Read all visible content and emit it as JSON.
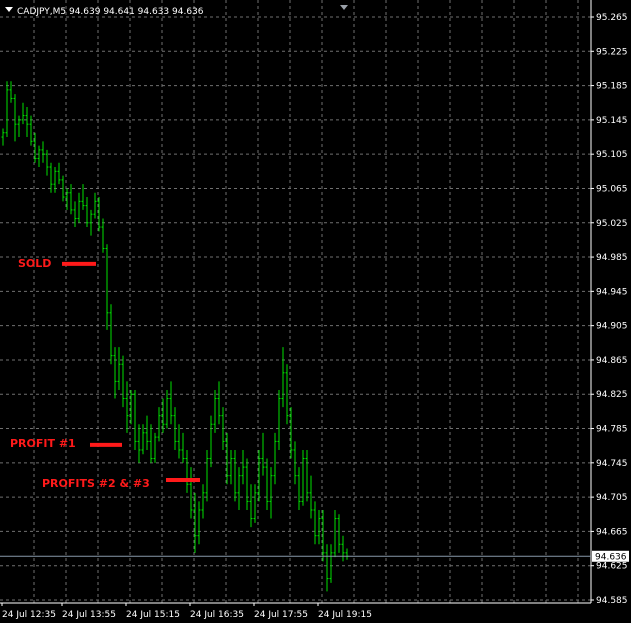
{
  "window": {
    "symbol_line": "CADJPY,M5  94.639 94.641 94.633 94.636",
    "current_price_label": "94.636"
  },
  "colors": {
    "background": "#000000",
    "grid": "#707070",
    "bars": "#00e000",
    "axis": "#ffffff",
    "annotation": "#ff1a1a",
    "current_line": "#8899aa"
  },
  "chart_data": {
    "type": "ohlc",
    "symbol": "CADJPY",
    "timeframe": "M5",
    "ylim": [
      94.575,
      95.275
    ],
    "y_ticks": [
      "95.265",
      "95.225",
      "95.185",
      "95.145",
      "95.105",
      "95.065",
      "95.025",
      "94.985",
      "94.945",
      "94.905",
      "94.865",
      "94.825",
      "94.785",
      "94.745",
      "94.705",
      "94.665",
      "94.625",
      "94.585"
    ],
    "x_ticks": [
      "24 Jul 12:35",
      "24 Jul 13:55",
      "24 Jul 15:15",
      "24 Jul 16:35",
      "24 Jul 17:55",
      "24 Jul 19:15"
    ],
    "current_price": 94.636,
    "grid": true,
    "annotations": [
      {
        "label": "SOLD",
        "price": 94.977
      },
      {
        "label": "PROFIT #1",
        "price": 94.766
      },
      {
        "label": "PROFITS #2 & #3",
        "price": 94.725
      }
    ],
    "bars": [
      [
        95.125,
        95.135,
        95.115,
        95.13
      ],
      [
        95.13,
        95.19,
        95.125,
        95.18
      ],
      [
        95.18,
        95.19,
        95.165,
        95.17
      ],
      [
        95.17,
        95.175,
        95.12,
        95.14
      ],
      [
        95.14,
        95.15,
        95.125,
        95.145
      ],
      [
        95.145,
        95.165,
        95.14,
        95.15
      ],
      [
        95.15,
        95.16,
        95.125,
        95.14
      ],
      [
        95.14,
        95.15,
        95.115,
        95.12
      ],
      [
        95.12,
        95.13,
        95.095,
        95.1
      ],
      [
        95.1,
        95.115,
        95.09,
        95.11
      ],
      [
        95.11,
        95.12,
        95.095,
        95.105
      ],
      [
        95.105,
        95.11,
        95.08,
        95.09
      ],
      [
        95.09,
        95.095,
        95.06,
        95.07
      ],
      [
        95.07,
        95.09,
        95.06,
        95.085
      ],
      [
        95.085,
        95.095,
        95.07,
        95.075
      ],
      [
        95.075,
        95.08,
        95.05,
        95.055
      ],
      [
        95.055,
        95.065,
        95.04,
        95.06
      ],
      [
        95.06,
        95.07,
        95.035,
        95.04
      ],
      [
        95.04,
        95.05,
        95.02,
        95.03
      ],
      [
        95.03,
        95.06,
        95.025,
        95.05
      ],
      [
        95.05,
        95.07,
        95.04,
        95.045
      ],
      [
        95.045,
        95.055,
        95.02,
        95.025
      ],
      [
        95.025,
        95.04,
        95.01,
        95.035
      ],
      [
        95.035,
        95.06,
        95.03,
        95.05
      ],
      [
        95.05,
        95.055,
        95.015,
        95.02
      ],
      [
        95.02,
        95.03,
        94.99,
        94.995
      ],
      [
        94.995,
        95.0,
        94.9,
        94.92
      ],
      [
        94.92,
        94.93,
        94.86,
        94.87
      ],
      [
        94.87,
        94.88,
        94.82,
        94.84
      ],
      [
        94.84,
        94.88,
        94.83,
        94.86
      ],
      [
        94.86,
        94.87,
        94.81,
        94.82
      ],
      [
        94.82,
        94.84,
        94.78,
        94.8
      ],
      [
        94.8,
        94.83,
        94.79,
        94.825
      ],
      [
        94.825,
        94.83,
        94.76,
        94.77
      ],
      [
        94.77,
        94.79,
        94.745,
        94.76
      ],
      [
        94.76,
        94.79,
        94.755,
        94.78
      ],
      [
        94.78,
        94.8,
        94.76,
        94.77
      ],
      [
        94.77,
        94.79,
        94.745,
        94.75
      ],
      [
        94.75,
        94.78,
        94.745,
        94.775
      ],
      [
        94.775,
        94.81,
        94.77,
        94.8
      ],
      [
        94.8,
        94.82,
        94.78,
        94.79
      ],
      [
        94.79,
        94.83,
        94.785,
        94.82
      ],
      [
        94.82,
        94.84,
        94.79,
        94.8
      ],
      [
        94.8,
        94.81,
        94.76,
        94.77
      ],
      [
        94.77,
        94.79,
        94.75,
        94.76
      ],
      [
        94.76,
        94.78,
        94.745,
        94.75
      ],
      [
        94.75,
        94.76,
        94.71,
        94.72
      ],
      [
        94.72,
        94.74,
        94.68,
        94.69
      ],
      [
        94.69,
        94.71,
        94.64,
        94.66
      ],
      [
        94.66,
        94.7,
        94.65,
        94.69
      ],
      [
        94.69,
        94.72,
        94.68,
        94.71
      ],
      [
        94.71,
        94.76,
        94.7,
        94.75
      ],
      [
        94.75,
        94.8,
        94.74,
        94.79
      ],
      [
        94.79,
        94.83,
        94.78,
        94.82
      ],
      [
        94.82,
        94.84,
        94.79,
        94.8
      ],
      [
        94.8,
        94.81,
        94.76,
        94.77
      ],
      [
        94.77,
        94.78,
        94.72,
        94.73
      ],
      [
        94.73,
        94.76,
        94.72,
        94.75
      ],
      [
        94.75,
        94.76,
        94.7,
        94.71
      ],
      [
        94.71,
        94.74,
        94.69,
        94.73
      ],
      [
        94.73,
        94.76,
        94.72,
        94.74
      ],
      [
        94.74,
        94.75,
        94.69,
        94.7
      ],
      [
        94.7,
        94.72,
        94.67,
        94.68
      ],
      [
        94.68,
        94.72,
        94.675,
        94.71
      ],
      [
        94.71,
        94.76,
        94.7,
        94.75
      ],
      [
        94.75,
        94.78,
        94.73,
        94.74
      ],
      [
        94.74,
        94.75,
        94.69,
        94.7
      ],
      [
        94.7,
        94.74,
        94.68,
        94.73
      ],
      [
        94.73,
        94.78,
        94.72,
        94.77
      ],
      [
        94.77,
        94.83,
        94.76,
        94.82
      ],
      [
        94.82,
        94.88,
        94.81,
        94.85
      ],
      [
        94.85,
        94.86,
        94.79,
        94.8
      ],
      [
        94.8,
        94.81,
        94.75,
        94.76
      ],
      [
        94.76,
        94.77,
        94.72,
        94.73
      ],
      [
        94.73,
        94.74,
        94.69,
        94.7
      ],
      [
        94.7,
        94.76,
        94.695,
        94.75
      ],
      [
        94.75,
        94.76,
        94.7,
        94.71
      ],
      [
        94.71,
        94.73,
        94.68,
        94.69
      ],
      [
        94.69,
        94.7,
        94.65,
        94.66
      ],
      [
        94.66,
        94.69,
        94.65,
        94.68
      ],
      [
        94.68,
        94.69,
        94.63,
        94.64
      ],
      [
        94.64,
        94.65,
        94.595,
        94.61
      ],
      [
        94.61,
        94.65,
        94.605,
        94.64
      ],
      [
        94.64,
        94.69,
        94.635,
        94.68
      ],
      [
        94.68,
        94.685,
        94.64,
        94.65
      ],
      [
        94.65,
        94.66,
        94.63,
        94.64
      ],
      [
        94.64,
        94.645,
        94.632,
        94.636
      ]
    ]
  }
}
